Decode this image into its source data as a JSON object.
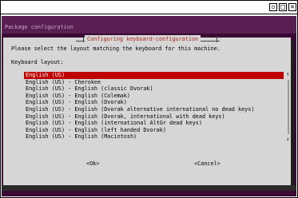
{
  "window": {
    "minimize_glyph": "▫",
    "maximize_glyph": "□",
    "close_glyph": "✕"
  },
  "header": {
    "title": "Package configuration"
  },
  "dialog": {
    "title": "Configuring keyboard-configuration",
    "prompt": "Please select the layout matching the keyboard for this machine.",
    "field_label": "Keyboard layout:",
    "items": [
      "English (US)",
      "English (US) - Cherokee",
      "English (US) - English (classic Dvorak)",
      "English (US) - English (Colemak)",
      "English (US) - English (Dvorak)",
      "English (US) - English (Dvorak alternative international no dead keys)",
      "English (US) - English (Dvorak, international with dead keys)",
      "English (US) - English (international AltGr dead keys)",
      "English (US) - English (left handed Dvorak)",
      "English (US) - English (Macintosh)"
    ],
    "selected_index": 0,
    "ok_label": "<Ok>",
    "cancel_label": "<Cancel>",
    "scroll_up": "↑",
    "scroll_down": "↓"
  },
  "colors": {
    "terminal_bg": "#3b0a34",
    "dialog_bg": "#d6d6d6",
    "selection": "#c00000",
    "title_text": "#b0231a"
  }
}
